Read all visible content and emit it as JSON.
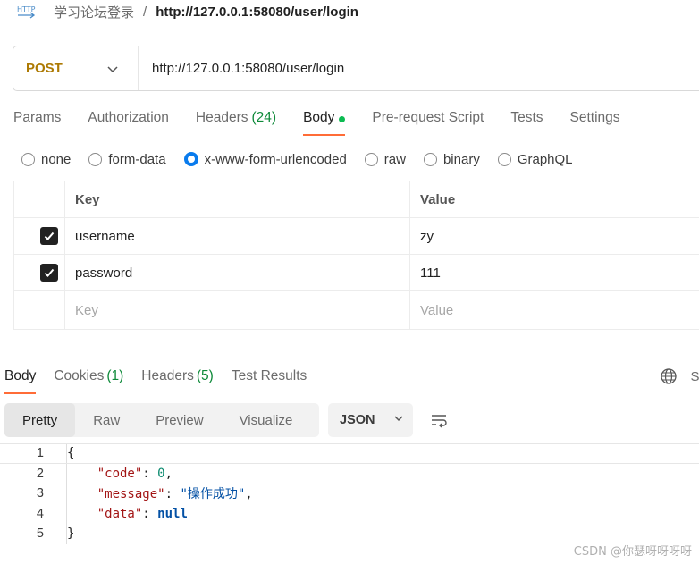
{
  "breadcrumb": {
    "icon": "http-request-icon",
    "parent": "学习论坛登录",
    "separator": "/",
    "current": "http://127.0.0.1:58080/user/login"
  },
  "request": {
    "method": "POST",
    "method_color": "#ad7a03",
    "url": "http://127.0.0.1:58080/user/login"
  },
  "request_tabs": [
    {
      "label": "Params",
      "count": ""
    },
    {
      "label": "Authorization",
      "count": ""
    },
    {
      "label": "Headers",
      "count": "(24)"
    },
    {
      "label": "Body",
      "count": "",
      "active": true
    },
    {
      "label": "Pre-request Script",
      "count": ""
    },
    {
      "label": "Tests",
      "count": ""
    },
    {
      "label": "Settings",
      "count": ""
    }
  ],
  "body_types": [
    {
      "label": "none",
      "selected": false
    },
    {
      "label": "form-data",
      "selected": false
    },
    {
      "label": "x-www-form-urlencoded",
      "selected": true
    },
    {
      "label": "raw",
      "selected": false
    },
    {
      "label": "binary",
      "selected": false
    },
    {
      "label": "GraphQL",
      "selected": false
    }
  ],
  "kv_table": {
    "headers": {
      "key": "Key",
      "value": "Value"
    },
    "rows": [
      {
        "key": "username",
        "value": "zy",
        "checked": true
      },
      {
        "key": "password",
        "value": "111",
        "checked": true
      }
    ],
    "placeholder": {
      "key": "Key",
      "value": "Value"
    }
  },
  "response_tabs": [
    {
      "label": "Body",
      "count": "",
      "active": true
    },
    {
      "label": "Cookies",
      "count": "(1)"
    },
    {
      "label": "Headers",
      "count": "(5)"
    },
    {
      "label": "Test Results",
      "count": ""
    }
  ],
  "response_status_partial": "Sta",
  "view_modes": [
    "Pretty",
    "Raw",
    "Preview",
    "Visualize"
  ],
  "active_view": "Pretty",
  "format": "JSON",
  "code_lines": [
    {
      "n": "1",
      "text": "{"
    },
    {
      "n": "2",
      "key": "\"code\"",
      "value": "0",
      "vtype": "num",
      "comma": ","
    },
    {
      "n": "3",
      "key": "\"message\"",
      "value": "\"操作成功\"",
      "vtype": "str",
      "comma": ","
    },
    {
      "n": "4",
      "key": "\"data\"",
      "value": "null",
      "vtype": "null",
      "comma": ""
    },
    {
      "n": "5",
      "text": "}"
    }
  ],
  "watermark": "CSDN @你瑟呀呀呀呀",
  "colors": {
    "accent": "#ff6c37",
    "count_green": "#0f8a3a",
    "radio_blue": "#097bed",
    "dot_green": "#0cbb52"
  }
}
